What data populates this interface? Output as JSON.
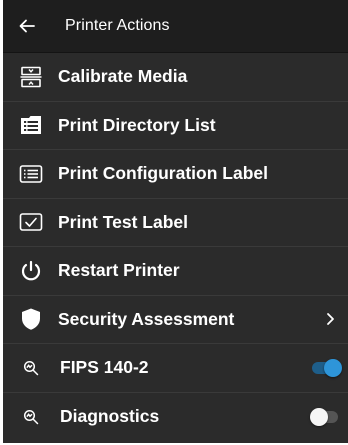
{
  "header": {
    "title": "Printer Actions",
    "back_icon": "arrow-left-icon"
  },
  "colors": {
    "background": "#2b2b2b",
    "header": "#1e1e1e",
    "accent": "#2e95d9",
    "text": "#ffffff"
  },
  "items": [
    {
      "label": "Calibrate Media",
      "icon": "calibrate-icon"
    },
    {
      "label": "Print Directory List",
      "icon": "directory-list-icon"
    },
    {
      "label": "Print Configuration Label",
      "icon": "configuration-label-icon"
    },
    {
      "label": "Print Test Label",
      "icon": "test-label-icon"
    },
    {
      "label": "Restart Printer",
      "icon": "power-icon"
    },
    {
      "label": "Security Assessment",
      "icon": "shield-icon",
      "trailing": "chevron-right-icon"
    },
    {
      "label": "FIPS 140-2",
      "icon": "magnify-icon",
      "toggle": true
    },
    {
      "label": "Diagnostics",
      "icon": "magnify-icon",
      "toggle": false
    }
  ]
}
